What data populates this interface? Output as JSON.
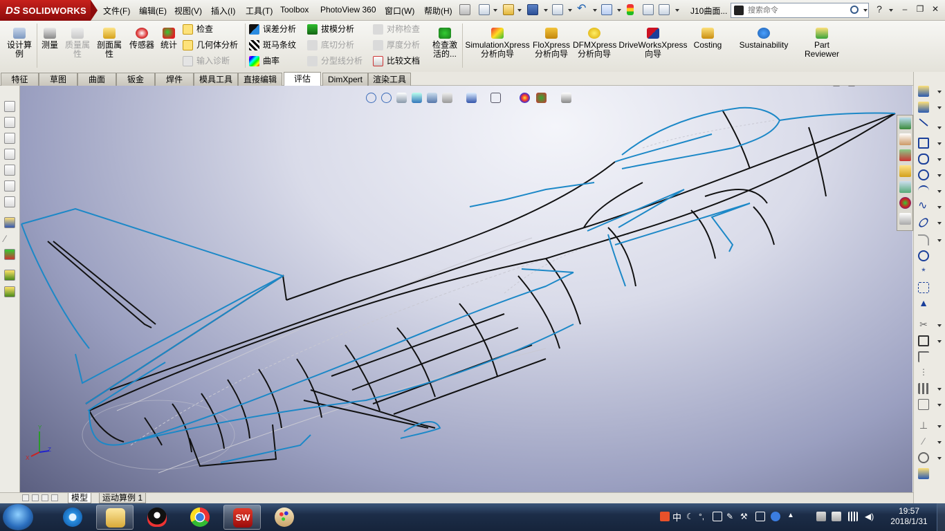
{
  "app": {
    "brand": "SOLIDWORKS",
    "brand_prefix": "DS"
  },
  "menu": [
    "文件(F)",
    "编辑(E)",
    "视图(V)",
    "插入(I)",
    "工具(T)",
    "Toolbox",
    "PhotoView 360",
    "窗口(W)",
    "帮助(H)"
  ],
  "document": {
    "title": "J10曲面..."
  },
  "search": {
    "placeholder": "搜索命令"
  },
  "help_label": "?",
  "command_manager": {
    "big_buttons": [
      {
        "label": "设计算例",
        "icon": "design-study-icon"
      },
      {
        "label": "测量",
        "icon": "measure-icon"
      },
      {
        "label": "质量属性",
        "icon": "mass-properties-icon",
        "disabled": true
      },
      {
        "label": "剖面属性",
        "icon": "section-properties-icon"
      },
      {
        "label": "传感器",
        "icon": "sensor-icon"
      },
      {
        "label": "统计",
        "icon": "statistics-icon"
      }
    ],
    "col1": [
      "检查",
      "几何体分析",
      "输入诊断"
    ],
    "col2": [
      "误差分析",
      "斑马条纹",
      "曲率"
    ],
    "col3": [
      "拔模分析",
      "底切分析",
      "分型线分析"
    ],
    "col4": [
      "对称检查",
      "厚度分析",
      "比较文档"
    ],
    "check_active": "检查激活的...",
    "addins": [
      {
        "line1": "SimulationXpress",
        "line2": "分析向导"
      },
      {
        "line1": "FloXpress",
        "line2": "分析向导"
      },
      {
        "line1": "DFMXpress",
        "line2": "分析向导"
      },
      {
        "line1": "DriveWorksXpress",
        "line2": "向导"
      },
      {
        "line1": "Costing",
        "line2": ""
      },
      {
        "line1": "Sustainability",
        "line2": ""
      },
      {
        "line1": "Part",
        "line2": "Reviewer"
      }
    ]
  },
  "tabs": [
    "特征",
    "草图",
    "曲面",
    "钣金",
    "焊件",
    "模具工具",
    "直接编辑",
    "评估",
    "DimXpert",
    "渲染工具"
  ],
  "active_tab": "评估",
  "bottom_tabs": [
    "模型",
    "运动算例 1"
  ],
  "active_bottom_tab": "模型",
  "triad": {
    "x": "X",
    "y": "Y",
    "z": "Z"
  },
  "taskbar": {
    "apps": [
      "ie-icon",
      "explorer-icon",
      "qq-icon",
      "chrome-icon",
      "solidworks-icon",
      "paint-icon"
    ],
    "ime": "中",
    "time": "19:57",
    "date": "2018/1/31"
  },
  "colors": {
    "accent_blue": "#1c88c7",
    "edge_black": "#111111",
    "brand_red": "#c0201a"
  }
}
